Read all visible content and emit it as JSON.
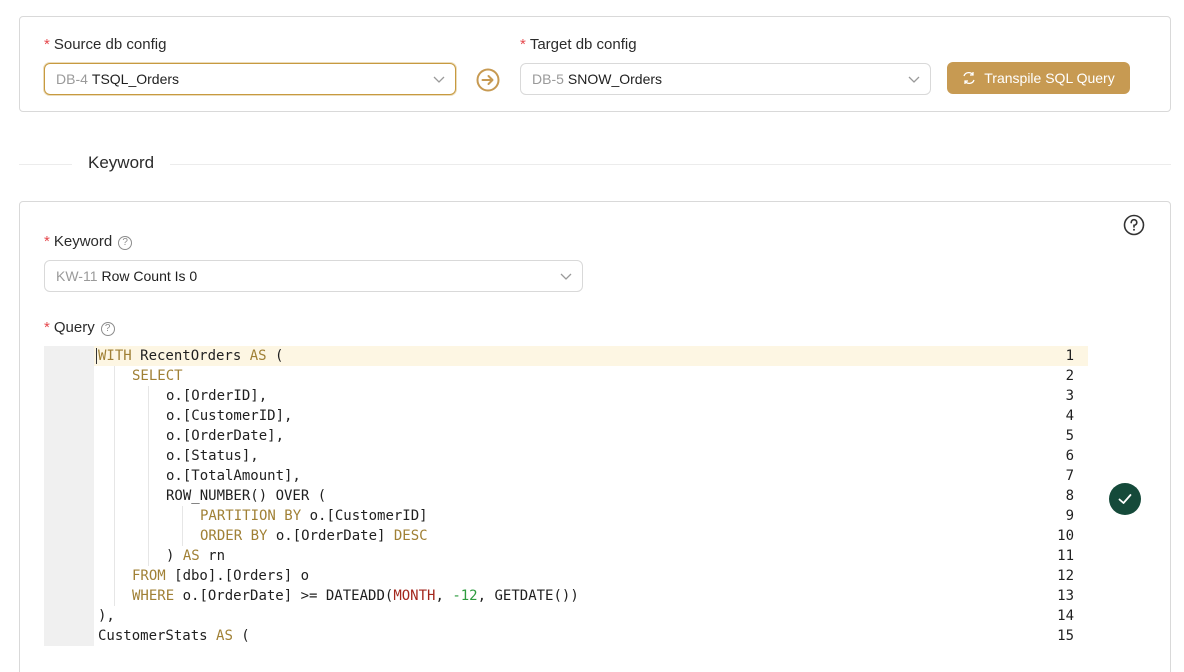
{
  "source": {
    "label": "Source db config",
    "required": "*",
    "prefix": "DB-4",
    "value": "TSQL_Orders"
  },
  "target": {
    "label": "Target db config",
    "required": "*",
    "prefix": "DB-5",
    "value": "SNOW_Orders"
  },
  "transpile_button": {
    "label": "Transpile SQL Query"
  },
  "section": {
    "title": "Keyword"
  },
  "keyword": {
    "label": "Keyword",
    "required": "*",
    "prefix": "KW-11",
    "value": "Row Count Is 0"
  },
  "query": {
    "label": "Query",
    "required": "*"
  },
  "editor": {
    "lines": [
      {
        "n": "1",
        "indent": 0,
        "tokens": [
          [
            "kw",
            "WITH"
          ],
          [
            "",
            " RecentOrders "
          ],
          [
            "kw",
            "AS"
          ],
          [
            "",
            " ("
          ]
        ]
      },
      {
        "n": "2",
        "indent": 1,
        "tokens": [
          [
            "kw",
            "SELECT"
          ]
        ]
      },
      {
        "n": "3",
        "indent": 2,
        "tokens": [
          [
            "",
            "o.[OrderID],"
          ]
        ]
      },
      {
        "n": "4",
        "indent": 2,
        "tokens": [
          [
            "",
            "o.[CustomerID],"
          ]
        ]
      },
      {
        "n": "5",
        "indent": 2,
        "tokens": [
          [
            "",
            "o.[OrderDate],"
          ]
        ]
      },
      {
        "n": "6",
        "indent": 2,
        "tokens": [
          [
            "",
            "o.[Status],"
          ]
        ]
      },
      {
        "n": "7",
        "indent": 2,
        "tokens": [
          [
            "",
            "o.[TotalAmount],"
          ]
        ]
      },
      {
        "n": "8",
        "indent": 2,
        "tokens": [
          [
            "",
            "ROW_NUMBER() OVER ("
          ]
        ]
      },
      {
        "n": "9",
        "indent": 3,
        "tokens": [
          [
            "kw",
            "PARTITION BY"
          ],
          [
            "",
            " o.[CustomerID]"
          ]
        ]
      },
      {
        "n": "10",
        "indent": 3,
        "tokens": [
          [
            "kw",
            "ORDER BY"
          ],
          [
            "",
            " o.[OrderDate] "
          ],
          [
            "kw",
            "DESC"
          ]
        ]
      },
      {
        "n": "11",
        "indent": 2,
        "tokens": [
          [
            "",
            ") "
          ],
          [
            "kw",
            "AS"
          ],
          [
            "",
            " rn"
          ]
        ]
      },
      {
        "n": "12",
        "indent": 1,
        "tokens": [
          [
            "kw",
            "FROM"
          ],
          [
            "",
            " [dbo].[Orders] o"
          ]
        ]
      },
      {
        "n": "13",
        "indent": 1,
        "tokens": [
          [
            "kw",
            "WHERE"
          ],
          [
            "",
            " o.[OrderDate] >= DATEADD("
          ],
          [
            "fn",
            "MONTH"
          ],
          [
            "",
            ", "
          ],
          [
            "num",
            "-12"
          ],
          [
            "",
            ", GETDATE())"
          ]
        ]
      },
      {
        "n": "14",
        "indent": 0,
        "tokens": [
          [
            "",
            "),"
          ]
        ]
      },
      {
        "n": "15",
        "indent": 0,
        "tokens": [
          [
            "",
            "CustomerStats "
          ],
          [
            "kw",
            "AS"
          ],
          [
            "",
            " ("
          ]
        ]
      }
    ]
  },
  "icons": {
    "transpile": "transpile-icon",
    "arrow": "arrow-right-circle-icon",
    "help": "question-circle-icon",
    "status": "check-circle-icon",
    "chevron": "chevron-down-icon"
  },
  "colors": {
    "accent": "#c79a52",
    "success": "#154a3a",
    "required": "#e5484d",
    "keyword": "#a08035"
  }
}
